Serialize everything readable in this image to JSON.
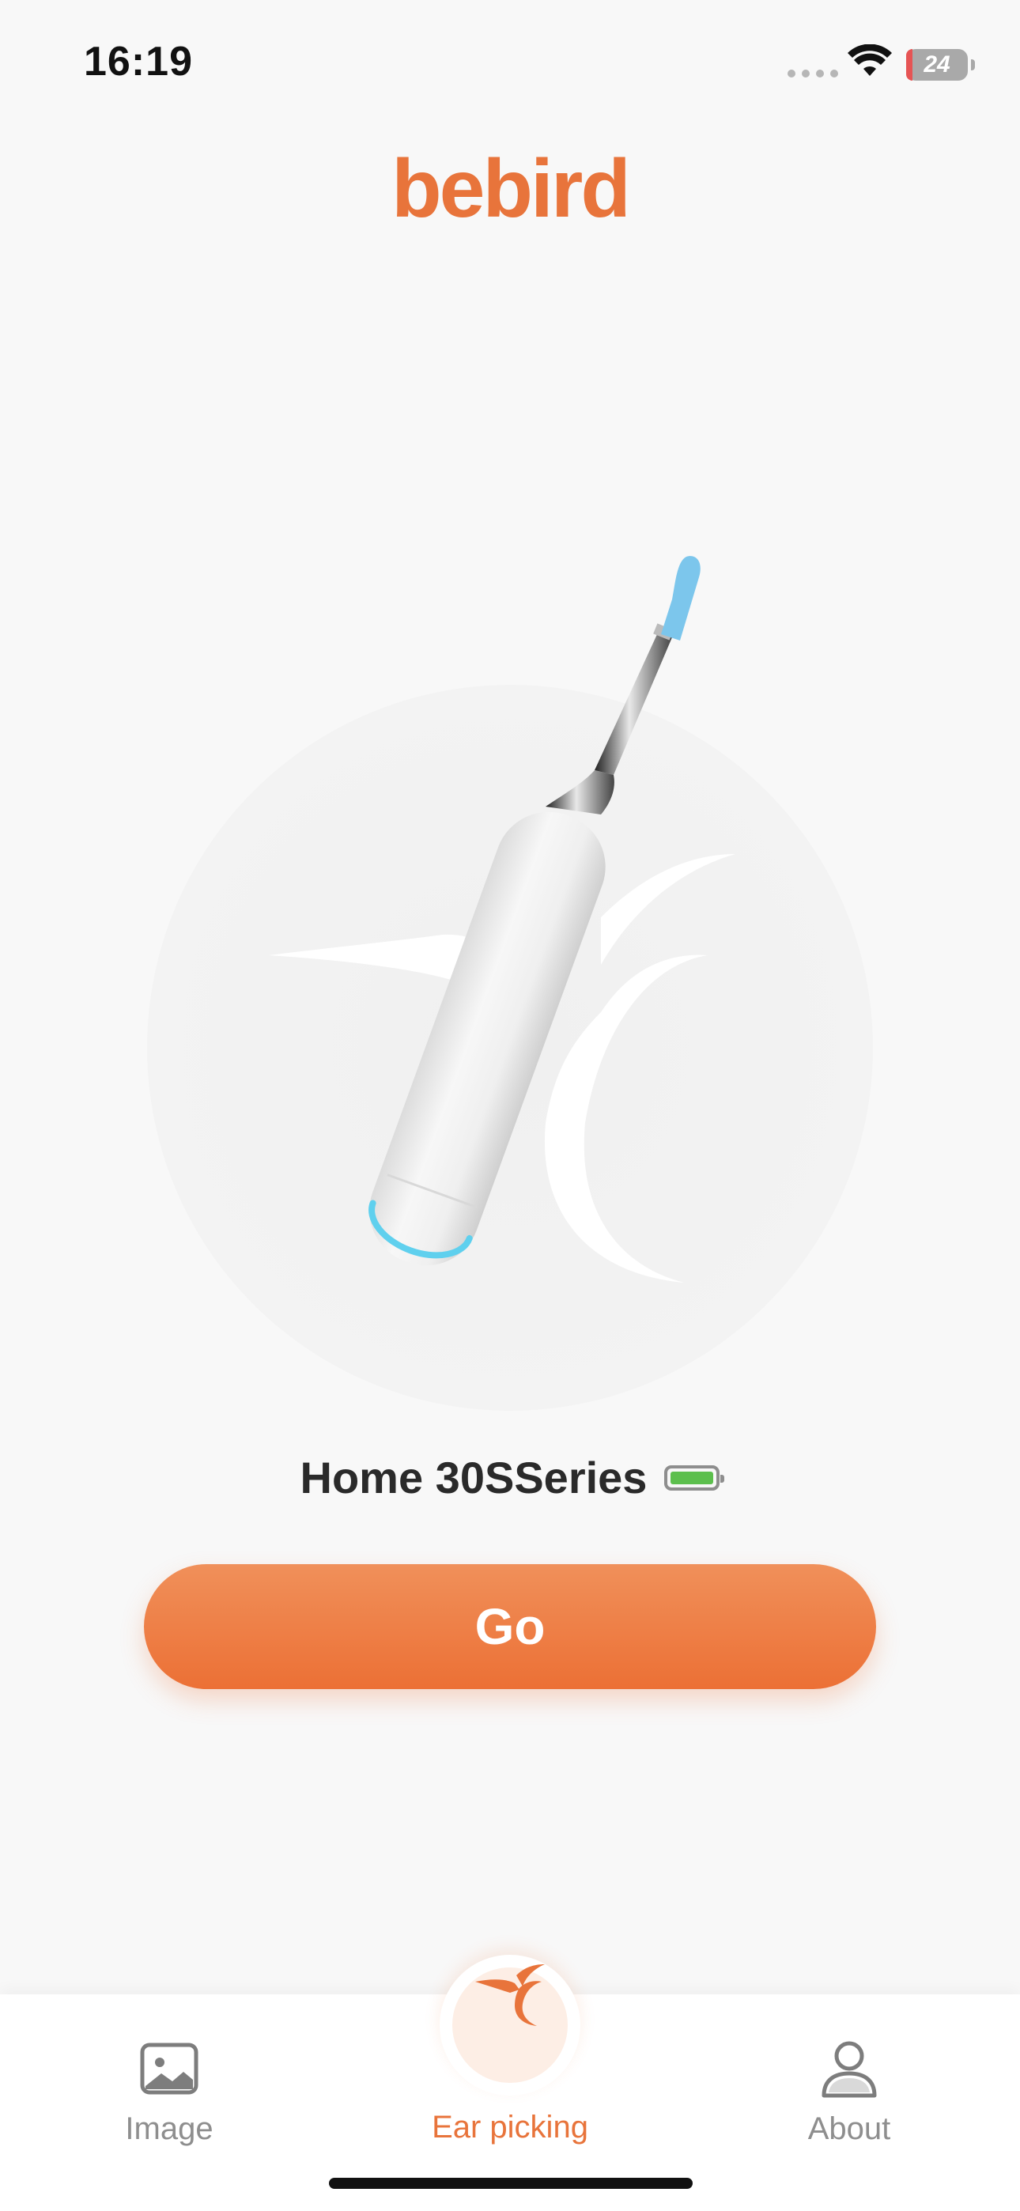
{
  "status_bar": {
    "time": "16:19",
    "battery_level": "24",
    "icons": [
      "signal-icon",
      "wifi-icon",
      "battery-icon"
    ]
  },
  "brand": {
    "logo_text": "bebird"
  },
  "device": {
    "name": "Home 30SSeries",
    "battery_status": "full"
  },
  "actions": {
    "go_label": "Go"
  },
  "tabs": [
    {
      "label": "Image",
      "icon": "image-icon",
      "active": false
    },
    {
      "label": "Ear picking",
      "icon": "bird-icon",
      "active": true
    },
    {
      "label": "About",
      "icon": "person-icon",
      "active": false
    }
  ],
  "colors": {
    "accent": "#ec7035",
    "inactive_tab": "#8e8e8e",
    "background": "#f8f8f8"
  }
}
